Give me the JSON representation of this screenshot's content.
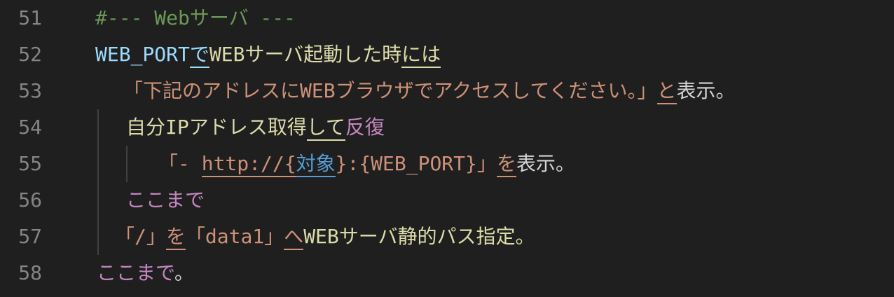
{
  "editor": {
    "lines": [
      {
        "number": "51",
        "tokens": [
          {
            "text": "#--- Webサーバ ---",
            "kind": "comment",
            "underline": false
          }
        ]
      },
      {
        "number": "52",
        "tokens": [
          {
            "text": "WEB_PORT",
            "kind": "var",
            "underline": false
          },
          {
            "text": "で",
            "kind": "var",
            "underline": true
          },
          {
            "text": "WEBサーバ起動した時",
            "kind": "text",
            "underline": false
          },
          {
            "text": "には",
            "kind": "text",
            "underline": true
          }
        ]
      },
      {
        "number": "53",
        "tokens": [
          {
            "text": "「下記のアドレスにWEBブラウザでアクセスしてください。」",
            "kind": "string",
            "underline": false
          },
          {
            "text": "と",
            "kind": "string",
            "underline": true
          },
          {
            "text": "表示。",
            "kind": "plain",
            "underline": false
          }
        ]
      },
      {
        "number": "54",
        "tokens": [
          {
            "text": "自分IPアドレス取得",
            "kind": "text",
            "underline": false
          },
          {
            "text": "して",
            "kind": "text",
            "underline": true
          },
          {
            "text": "反復",
            "kind": "keyword",
            "underline": false
          }
        ]
      },
      {
        "number": "55",
        "tokens": [
          {
            "text": "「- ",
            "kind": "string",
            "underline": false
          },
          {
            "text": "http://{",
            "kind": "string",
            "underline": true
          },
          {
            "text": "対象",
            "kind": "interp",
            "underline": true
          },
          {
            "text": "}:{WEB_PORT}」",
            "kind": "string",
            "underline": false
          },
          {
            "text": "を",
            "kind": "string",
            "underline": true
          },
          {
            "text": "表示。",
            "kind": "plain",
            "underline": false
          }
        ]
      },
      {
        "number": "56",
        "tokens": [
          {
            "text": "ここまで",
            "kind": "keyword",
            "underline": false
          }
        ]
      },
      {
        "number": "57",
        "tokens": [
          {
            "text": "「/」",
            "kind": "string",
            "underline": false
          },
          {
            "text": "を",
            "kind": "string",
            "underline": true
          },
          {
            "text": "「data1」",
            "kind": "string",
            "underline": false
          },
          {
            "text": "へ",
            "kind": "string",
            "underline": true
          },
          {
            "text": "WEBサーバ静的パス指定。",
            "kind": "text",
            "underline": false
          }
        ]
      },
      {
        "number": "58",
        "tokens": [
          {
            "text": "ここまで",
            "kind": "keyword",
            "underline": false
          },
          {
            "text": "。",
            "kind": "plain",
            "underline": false
          }
        ]
      }
    ],
    "colors": {
      "background": "#1f1f1f",
      "line_number": "#858585",
      "comment": "#6a9955",
      "variable": "#9cdcfe",
      "text": "#dcdcaa",
      "string": "#ce9178",
      "keyword": "#c586c0",
      "plain": "#d4d4d4",
      "interpolation": "#569cd6"
    }
  }
}
